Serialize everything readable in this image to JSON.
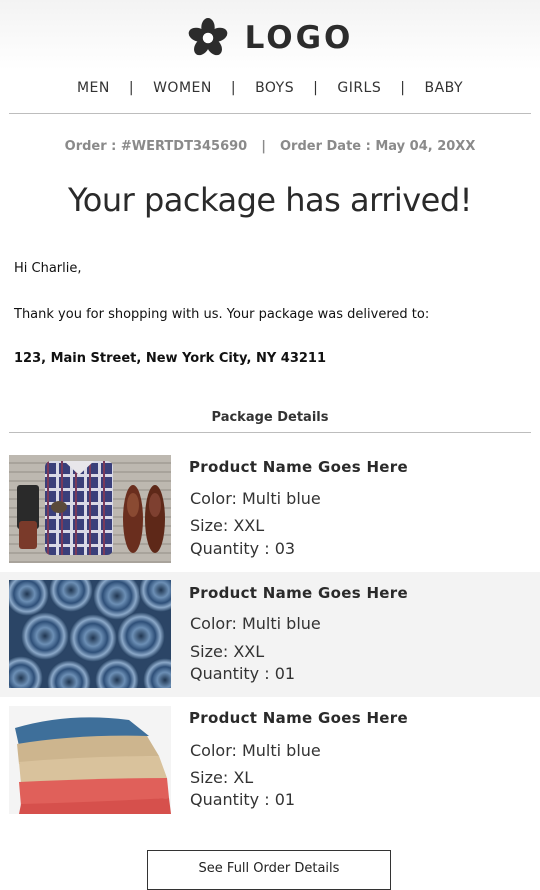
{
  "brand": {
    "logo_text": "LOGO"
  },
  "nav": {
    "items": [
      "MEN",
      "WOMEN",
      "BOYS",
      "GIRLS",
      "BABY"
    ],
    "separator": "|"
  },
  "order": {
    "number_label": "Order : #WERTDT345690",
    "separator": "|",
    "date_label": "Order Date : May 04, 20XX"
  },
  "headline": "Your package has arrived!",
  "greeting": "Hi Charlie,",
  "message": "Thank you for shopping with us. Your package was delivered to:",
  "address": "123, Main Street, New York City, NY 43211",
  "package": {
    "title": "Package Details",
    "products": [
      {
        "name": "Product Name Goes Here",
        "color": "Color: Multi blue",
        "size": "Size: XXL",
        "quantity": "Quantity : 03",
        "image_icon": "flatlay-clothes-shoes-image"
      },
      {
        "name": "Product Name Goes Here",
        "color": "Color: Multi blue",
        "size": "Size: XXL",
        "quantity": "Quantity : 01",
        "image_icon": "rolled-jeans-image"
      },
      {
        "name": "Product Name Goes Here",
        "color": "Color: Multi blue",
        "size": "Size: XL",
        "quantity": "Quantity : 01",
        "image_icon": "folded-pants-image"
      }
    ]
  },
  "cta": {
    "label": "See Full Order Details"
  },
  "colors": {
    "row_alt": "#f3f3f3",
    "muted": "#8a8a8a",
    "text": "#222222"
  }
}
